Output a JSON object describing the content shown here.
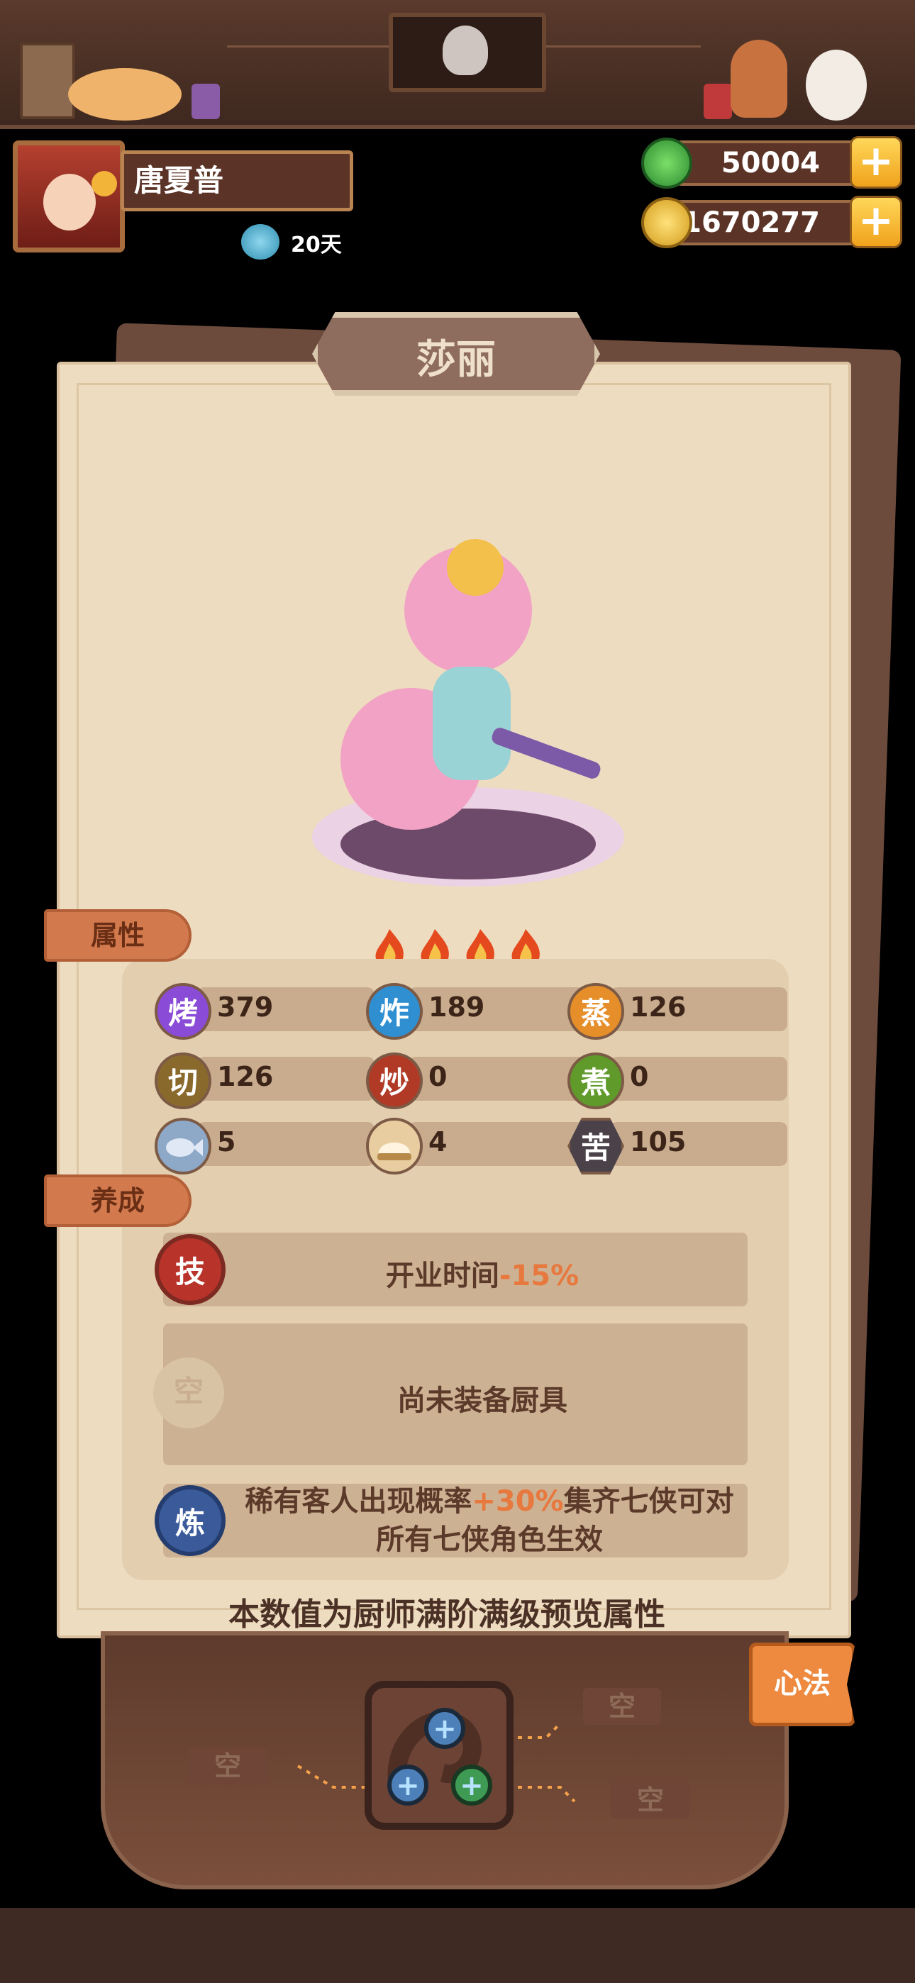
{
  "header": {
    "player_name": "唐夏普",
    "days_label": "20天"
  },
  "currency": {
    "jade": "50004",
    "coins": "1670277",
    "plus": "+"
  },
  "card": {
    "character_name": "莎丽",
    "stars": 4
  },
  "sections": {
    "attributes_tab": "属性",
    "nurture_tab": "养成"
  },
  "stats": [
    {
      "icon": "烤",
      "value": "379",
      "color": "#8a4bd6"
    },
    {
      "icon": "炸",
      "value": "189",
      "color": "#2f8fd1"
    },
    {
      "icon": "蒸",
      "value": "126",
      "color": "#e58e2a"
    },
    {
      "icon": "切",
      "value": "126",
      "color": "#8a6a2c"
    },
    {
      "icon": "炒",
      "value": "0",
      "color": "#b03a26"
    },
    {
      "icon": "煮",
      "value": "0",
      "color": "#5f9a2a"
    },
    {
      "icon": "fish",
      "value": "5",
      "color": "#8ea8c8"
    },
    {
      "icon": "bun",
      "value": "4",
      "color": "#e8cda0"
    },
    {
      "icon": "苦",
      "value": "105",
      "color": "#4a4248"
    }
  ],
  "nurture": {
    "skill_badge": "技",
    "skill_text_a": "开业时间",
    "skill_text_b": "-15%",
    "equip_badge": "空",
    "equip_text": "尚未装备厨具",
    "refine_badge": "炼",
    "refine_text_a": "稀有客人出现概率",
    "refine_text_b": "+30%",
    "refine_text_c": "集齐七侠可对",
    "refine_text_d": "所有七侠角色生效"
  },
  "footnote": "本数值为厨师满阶满级预览属性",
  "bottom": {
    "xinfa_label": "心法",
    "empty_1": "空",
    "empty_2": "空",
    "empty_3": "空"
  }
}
